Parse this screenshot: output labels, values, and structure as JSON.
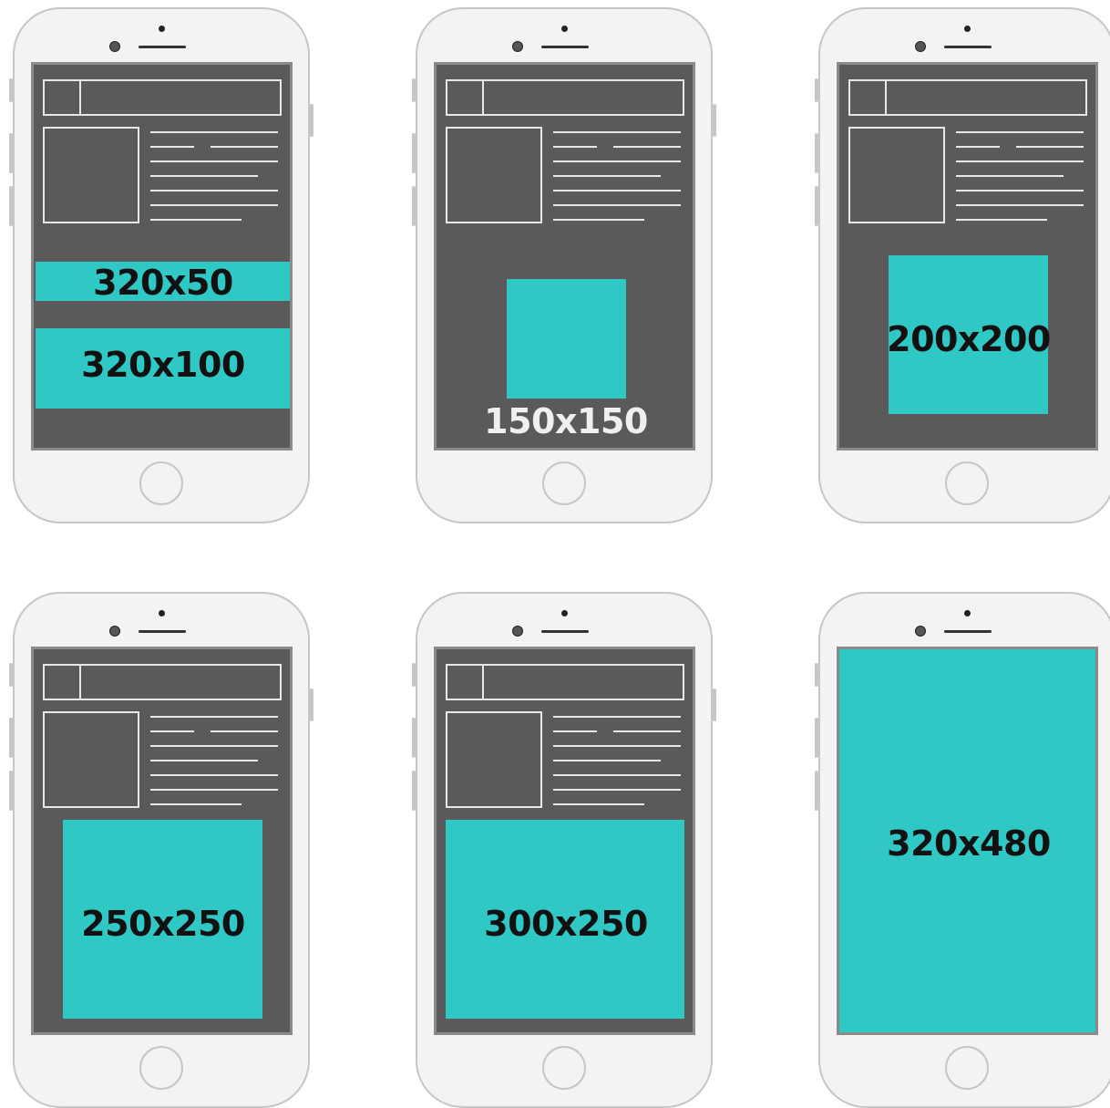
{
  "colors": {
    "phone_body": "#f3f3f3",
    "phone_outline": "#c6c6c6",
    "screen": "#5a5a5a",
    "wireframe": "#e8e8e8",
    "ad_unit": "#30c8c5",
    "label_dark": "#111111",
    "label_light": "#f0f0f0"
  },
  "phones": [
    {
      "labels": [
        "320x50",
        "320x100"
      ]
    },
    {
      "labels": [
        "150x150"
      ]
    },
    {
      "labels": [
        "200x200"
      ]
    },
    {
      "labels": [
        "250x250"
      ]
    },
    {
      "labels": [
        "300x250"
      ]
    },
    {
      "labels": [
        "320x480"
      ]
    }
  ]
}
